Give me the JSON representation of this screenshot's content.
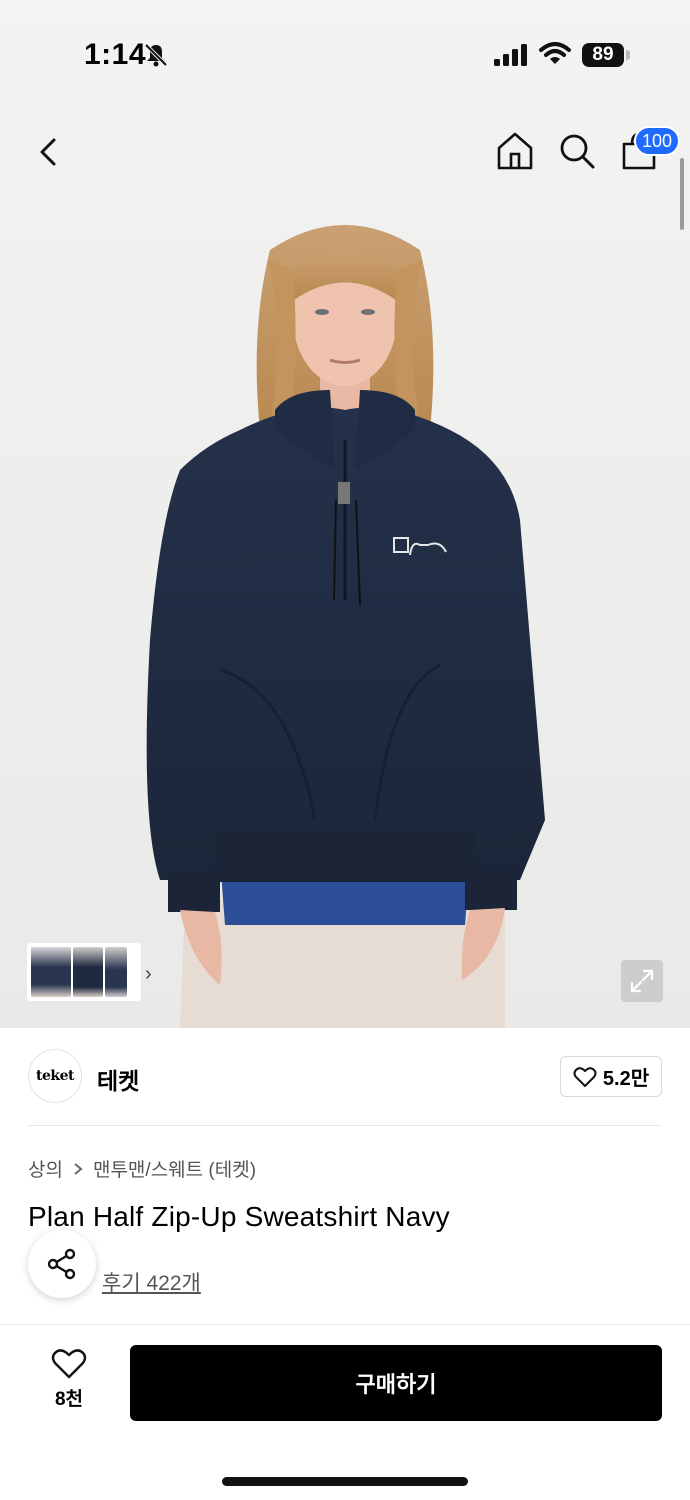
{
  "status_bar": {
    "time": "1:14",
    "battery": "89",
    "icons": [
      "bell-slash-icon",
      "signal-icon",
      "wifi-icon",
      "battery-icon"
    ]
  },
  "nav": {
    "icons": [
      "chevron-left-icon",
      "home-icon",
      "search-icon",
      "cart-icon"
    ],
    "cart_badge": "100"
  },
  "hero": {
    "thumbnail_icons": [
      "chevron-right-icon"
    ],
    "expand_icon": "expand-icon"
  },
  "brand": {
    "logo_text": "teket",
    "name": "테켓",
    "like_count": "5.2만",
    "like_icon": "heart-outline-icon"
  },
  "breadcrumb": {
    "category": "상의",
    "subcategory": "맨투맨/스웨트 (테켓)"
  },
  "product": {
    "title": "Plan Half Zip-Up Sweatshirt Navy",
    "review_link": "후기 422개",
    "share_icon": "share-icon"
  },
  "bottom_bar": {
    "wish_count": "8천",
    "buy_label": "구매하기"
  },
  "colors": {
    "badge": "#1f6bff",
    "buy_button": "#000000",
    "sweatshirt": "#1f2c44",
    "inner_shirt": "#2d4f98"
  }
}
